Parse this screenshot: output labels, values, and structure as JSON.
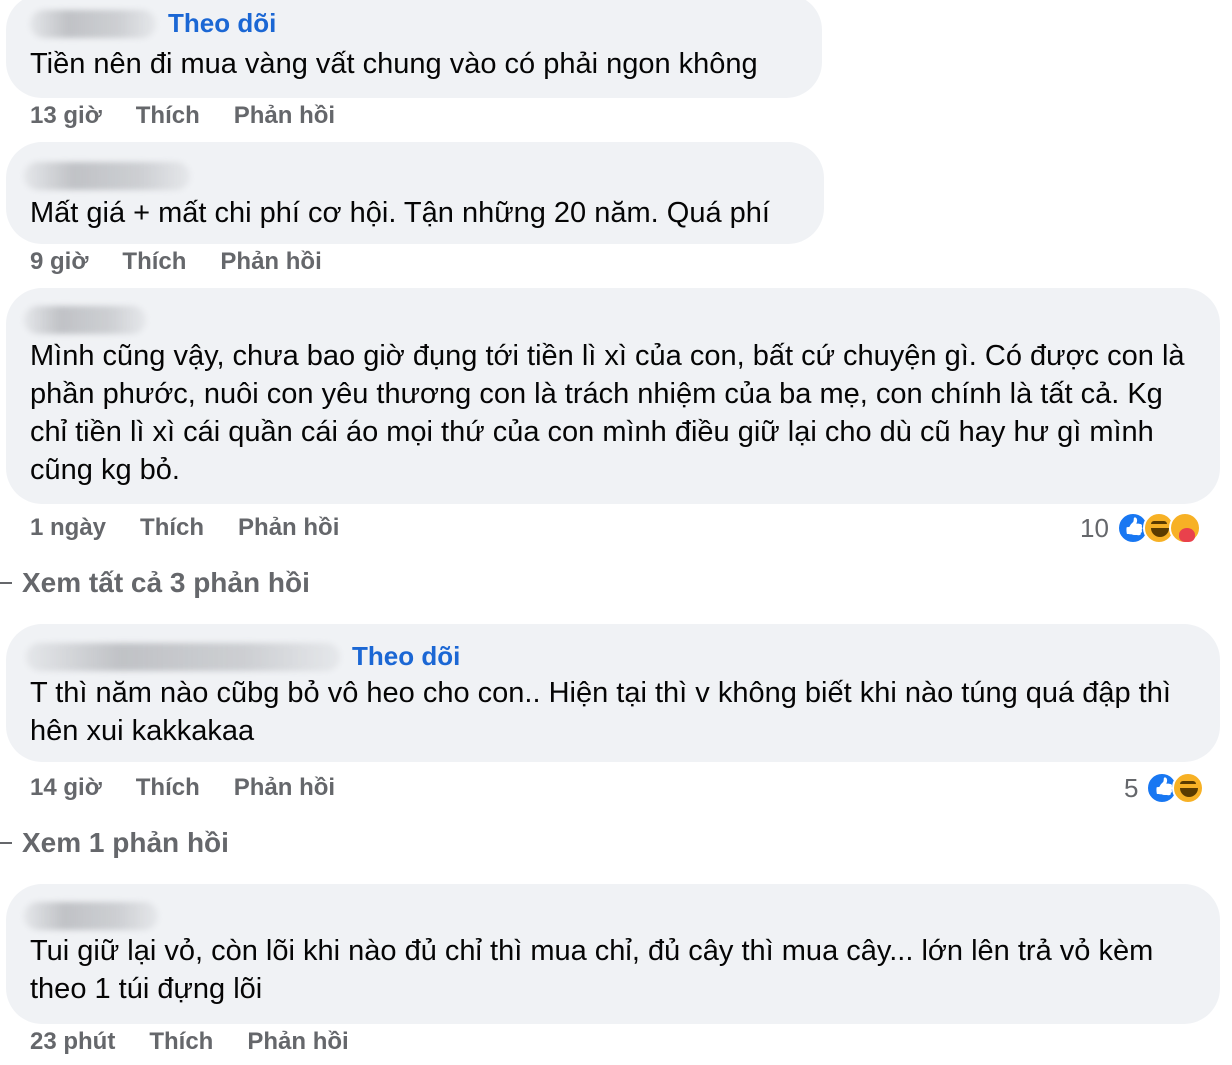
{
  "comments": [
    {
      "follow_label": "Theo dõi",
      "text": "Tiền nên đi mua vàng vất chung vào có phải ngon không",
      "time": "13 giờ",
      "like_label": "Thích",
      "reply_label": "Phản hồi"
    },
    {
      "text": "Mất giá + mất chi phí cơ hội. Tận những 20 năm. Quá phí",
      "time": "9 giờ",
      "like_label": "Thích",
      "reply_label": "Phản hồi"
    },
    {
      "text": "Mình cũng vậy, chưa bao giờ đụng tới tiền lì xì của con, bất cứ chuyện gì. Có được con là phần phước, nuôi con yêu thương con là trách nhiệm của ba mẹ, con chính là tất cả. Kg chỉ tiền lì xì cái quần cái áo mọi thứ của con mình điều giữ lại cho dù cũ hay hư gì mình cũng kg bỏ.",
      "time": "1 ngày",
      "like_label": "Thích",
      "reply_label": "Phản hồi",
      "reaction_count": "10",
      "reaction_icons": [
        "like-icon",
        "haha-icon",
        "care-icon"
      ],
      "view_replies": "Xem tất cả 3 phản hồi"
    },
    {
      "follow_label": "Theo dõi",
      "text": "T thì năm nào cũbg bỏ vô heo cho con.. Hiện tại thì v không biết khi nào túng quá đập thì hên xui kakkakaa",
      "time": "14 giờ",
      "like_label": "Thích",
      "reply_label": "Phản hồi",
      "reaction_count": "5",
      "reaction_icons": [
        "like-icon",
        "haha-icon"
      ],
      "view_replies": "Xem 1 phản hồi"
    },
    {
      "text": "Tui giữ lại vỏ, còn lõi khi nào đủ chỉ thì mua chỉ, đủ cây thì mua cây... lớn lên trả vỏ kèm theo 1 túi đựng lõi",
      "time": "23 phút",
      "like_label": "Thích",
      "reply_label": "Phản hồi"
    }
  ]
}
